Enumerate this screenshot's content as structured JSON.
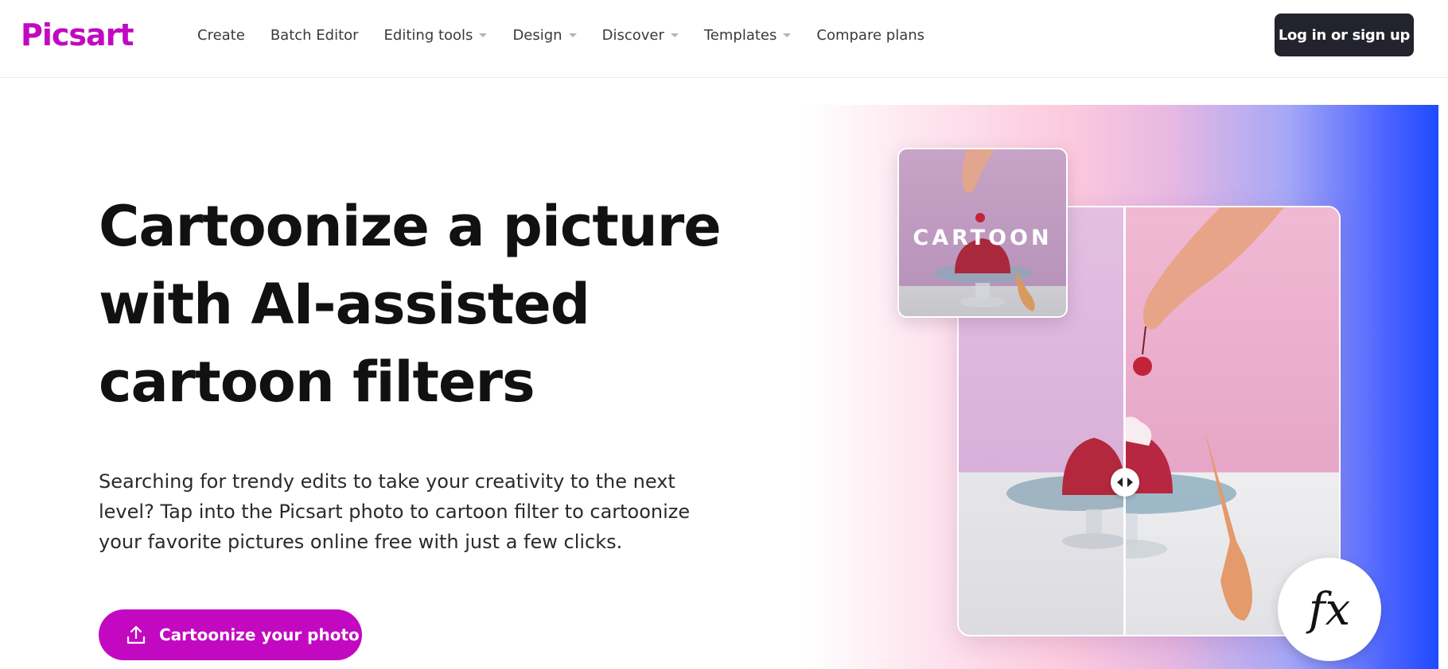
{
  "header": {
    "logo_text": "Picsart",
    "nav": [
      {
        "label": "Create",
        "has_dropdown": false
      },
      {
        "label": "Batch Editor",
        "has_dropdown": false
      },
      {
        "label": "Editing tools",
        "has_dropdown": true
      },
      {
        "label": "Design",
        "has_dropdown": true
      },
      {
        "label": "Discover",
        "has_dropdown": true
      },
      {
        "label": "Templates",
        "has_dropdown": true
      },
      {
        "label": "Compare plans",
        "has_dropdown": false
      }
    ],
    "login_label": "Log in or sign up"
  },
  "hero": {
    "title_lines": [
      "Cartoonize a picture",
      "with AI-assisted",
      "cartoon filters"
    ],
    "description": "Searching for trendy edits to take your creativity to the next level? Tap into the Picsart photo to cartoon filter to cartoonize your favorite pictures online free with just a few clicks.",
    "cta_label": "Cartoonize your photo",
    "cta_icon": "upload-icon"
  },
  "visual": {
    "thumb_label": "CARTOON",
    "fx_label": "fx",
    "handle_icon": "left-right-arrows-icon"
  },
  "colors": {
    "brand": "#c209c1",
    "login_bg": "#23232d",
    "gradient_end": "#1e4bff"
  }
}
